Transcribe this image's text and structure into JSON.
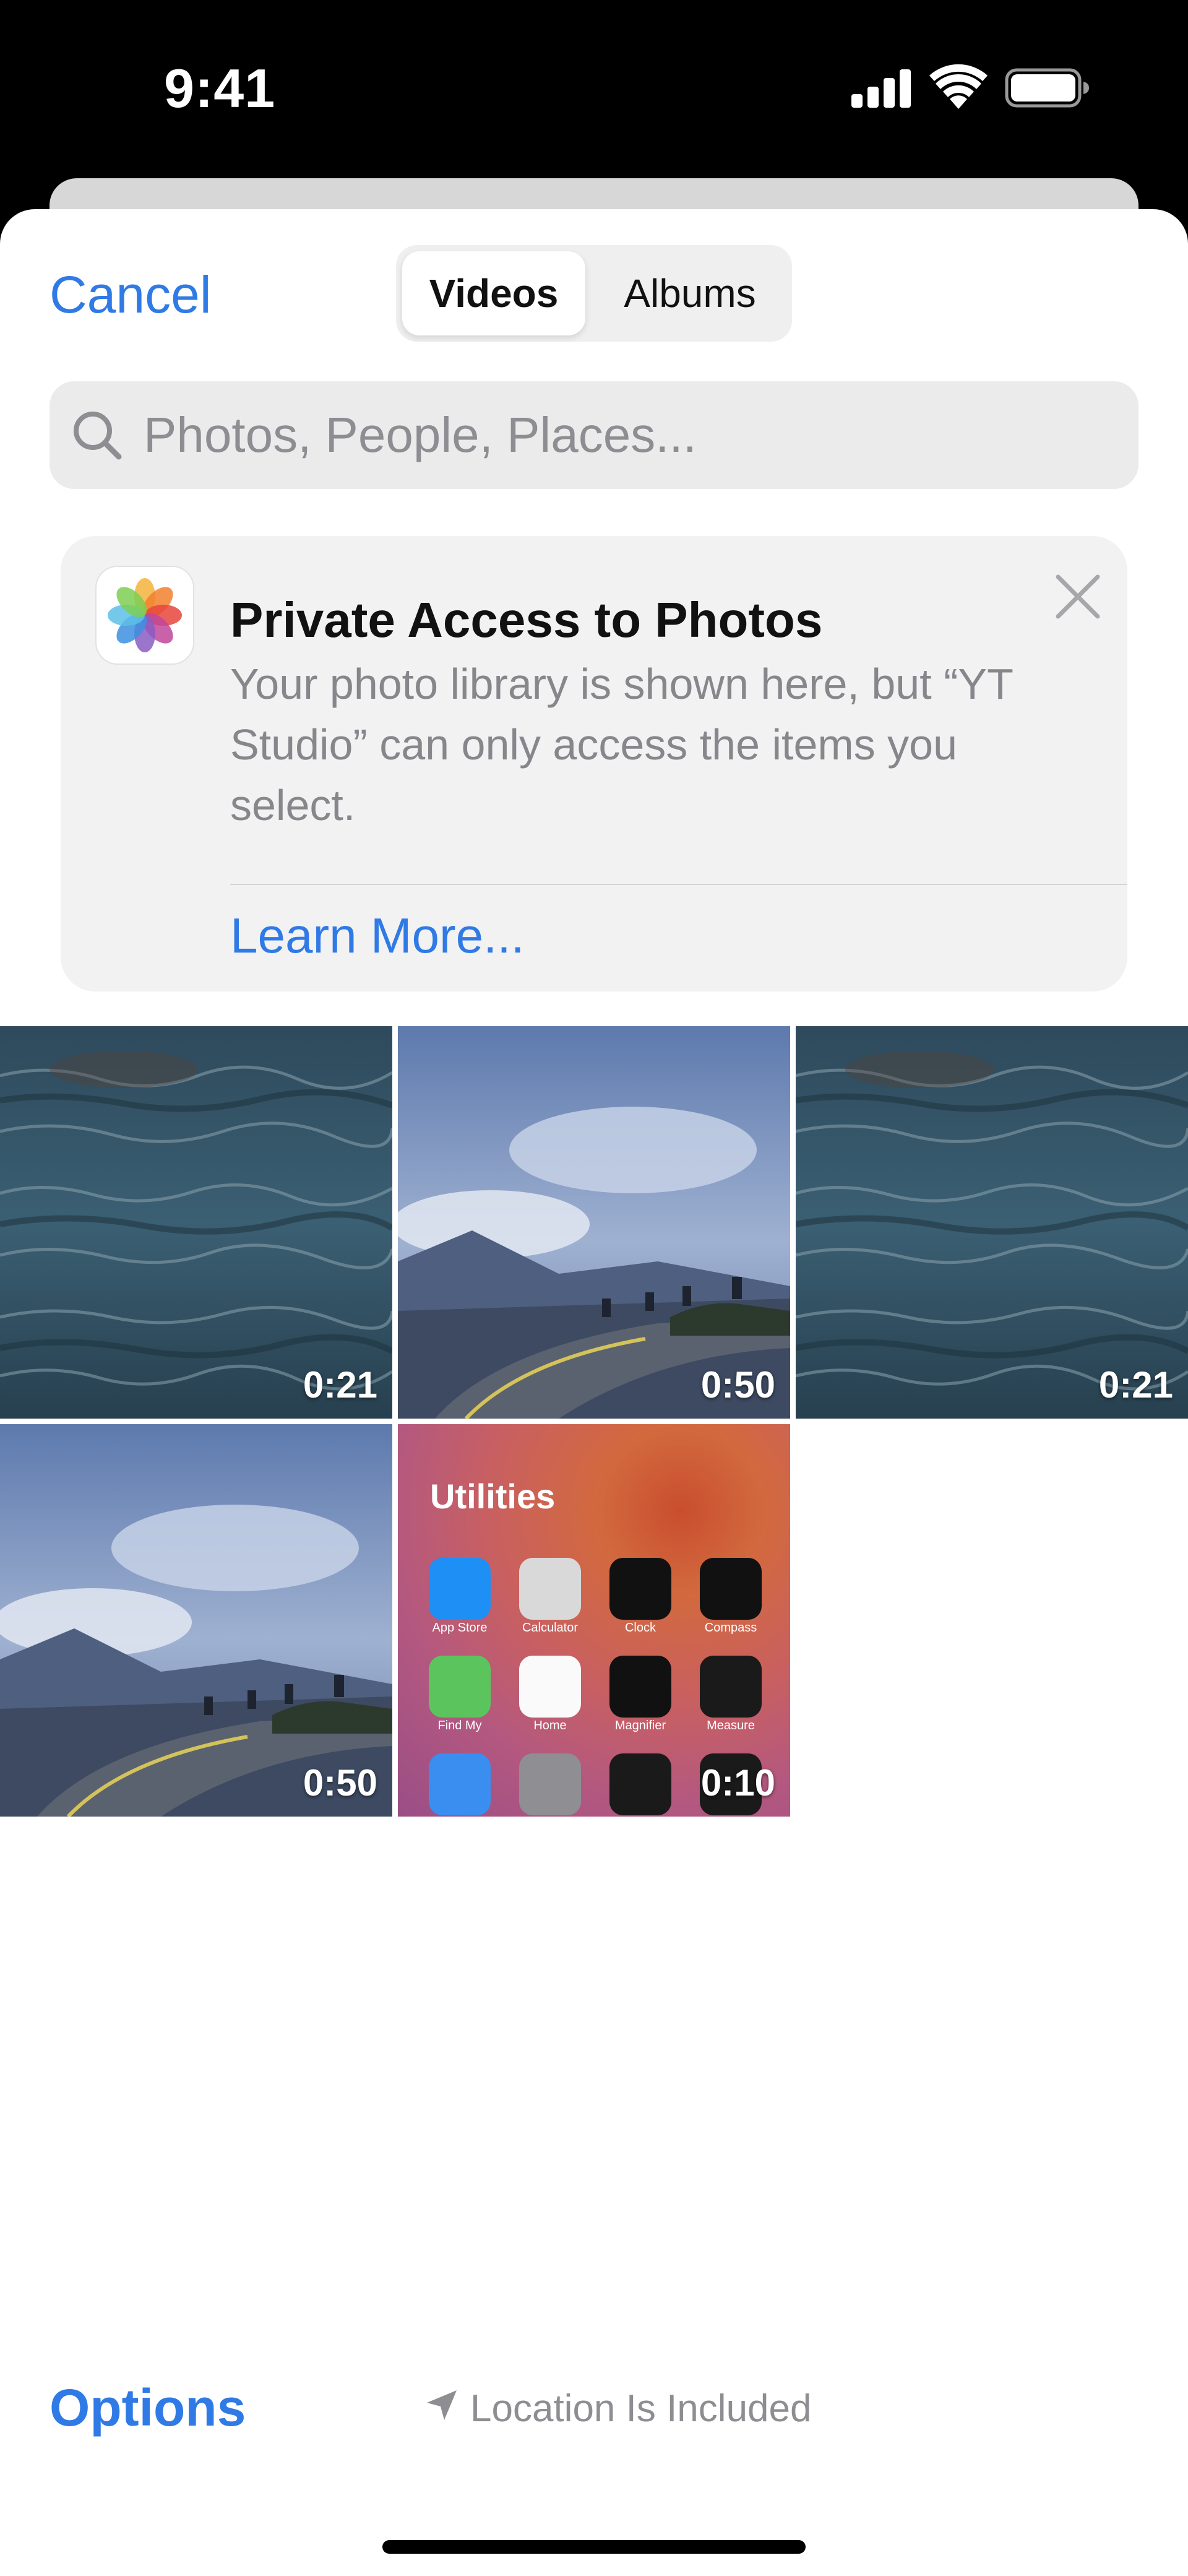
{
  "status_bar": {
    "time": "9:41"
  },
  "header": {
    "cancel_label": "Cancel",
    "tabs": [
      {
        "label": "Videos",
        "selected": true
      },
      {
        "label": "Albums",
        "selected": false
      }
    ]
  },
  "search": {
    "placeholder": "Photos, People, Places..."
  },
  "info_card": {
    "title": "Private Access to Photos",
    "body": "Your photo library is shown here, but “YT Studio” can only access the items you select.",
    "link_label": "Learn More..."
  },
  "grid": {
    "items": [
      {
        "type": "ocean-waves",
        "duration": "0:21"
      },
      {
        "type": "mountain-road",
        "duration": "0:50"
      },
      {
        "type": "ocean-waves",
        "duration": "0:21"
      },
      {
        "type": "mountain-road",
        "duration": "0:50"
      },
      {
        "type": "utilities-screenshot",
        "duration": "0:10",
        "folder_title": "Utilities",
        "apps": [
          "App Store",
          "Calculator",
          "Clock",
          "Compass",
          "Find My",
          "Home",
          "Magnifier",
          "Measure"
        ]
      }
    ]
  },
  "footer": {
    "options_label": "Options",
    "location_text": "Location Is Included"
  },
  "colors": {
    "accent": "#2f7ae5",
    "secondary_text": "#8d8d92",
    "card_background": "#f2f2f3"
  }
}
